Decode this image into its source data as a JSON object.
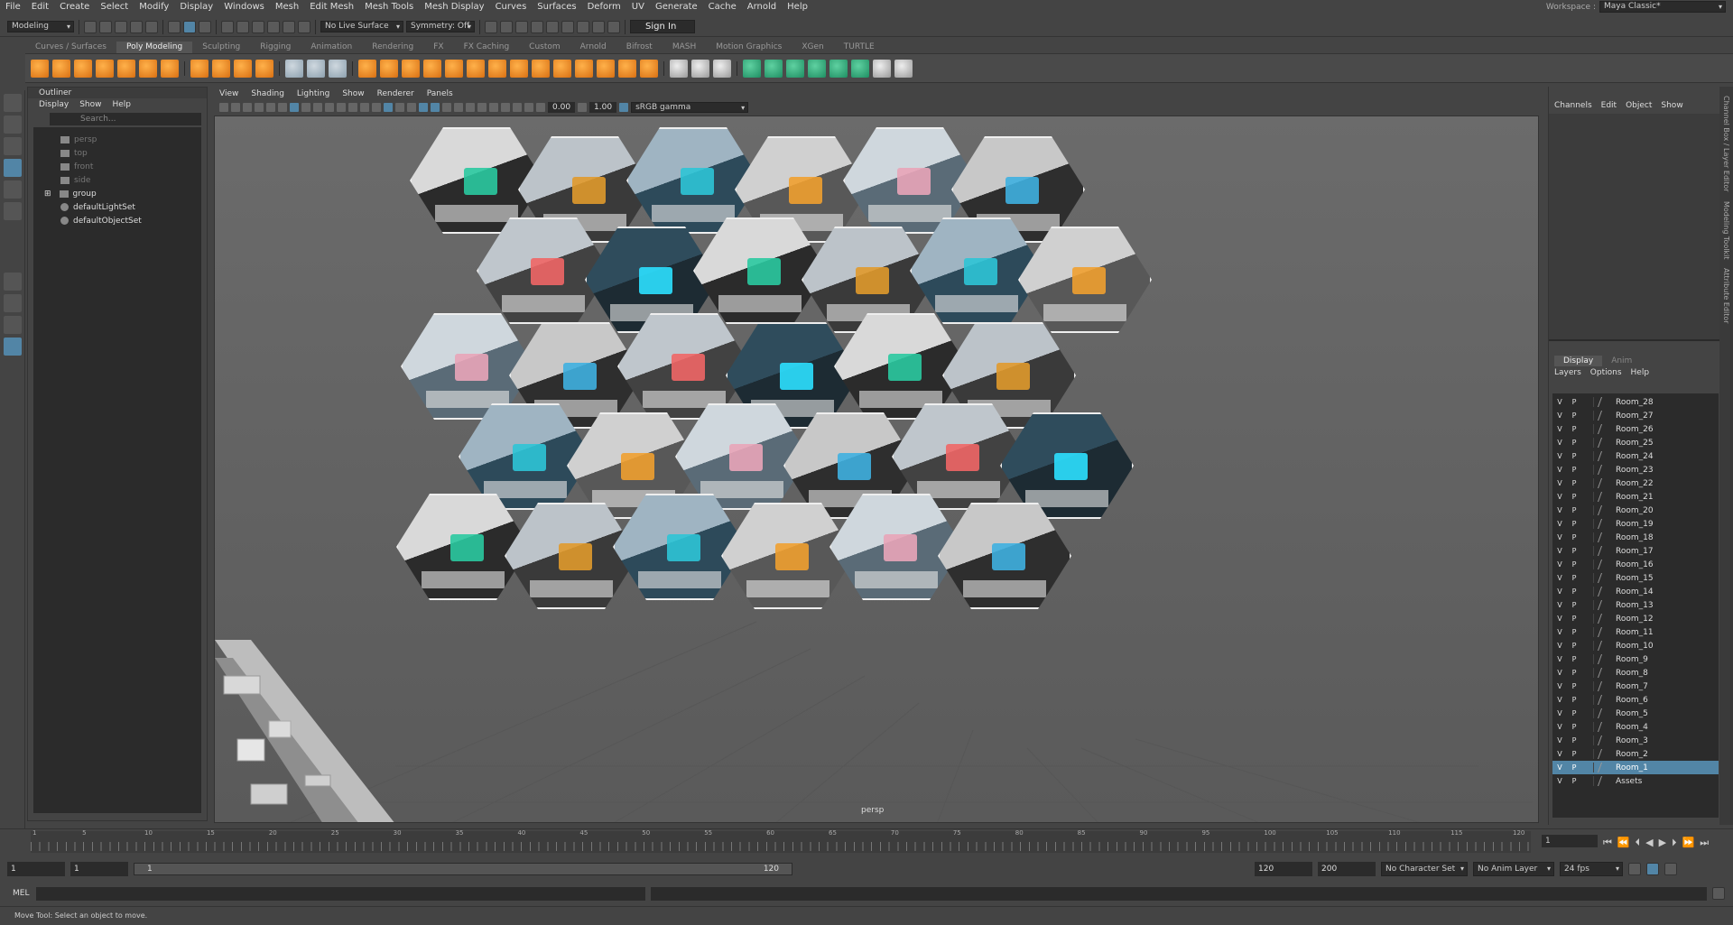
{
  "menubar": {
    "items": [
      "File",
      "Edit",
      "Create",
      "Select",
      "Modify",
      "Display",
      "Windows",
      "Mesh",
      "Edit Mesh",
      "Mesh Tools",
      "Mesh Display",
      "Curves",
      "Surfaces",
      "Deform",
      "UV",
      "Generate",
      "Cache",
      "Arnold",
      "Help"
    ],
    "workspace_label": "Workspace :",
    "workspace_value": "Maya Classic*"
  },
  "statusline": {
    "mode": "Modeling",
    "live_surface": "No Live Surface",
    "symmetry": "Symmetry: Off",
    "sign_in": "Sign In"
  },
  "shelf": {
    "tabs": [
      "Curves / Surfaces",
      "Poly Modeling",
      "Sculpting",
      "Rigging",
      "Animation",
      "Rendering",
      "FX",
      "FX Caching",
      "Custom",
      "Arnold",
      "Bifrost",
      "MASH",
      "Motion Graphics",
      "XGen",
      "TURTLE"
    ],
    "active_tab": "Poly Modeling"
  },
  "outliner": {
    "title": "Outliner",
    "menu": [
      "Display",
      "Show",
      "Help"
    ],
    "search_placeholder": "Search...",
    "items": [
      {
        "label": "persp",
        "icon": "camera-icon",
        "dim": true
      },
      {
        "label": "top",
        "icon": "camera-icon",
        "dim": true
      },
      {
        "label": "front",
        "icon": "camera-icon",
        "dim": true
      },
      {
        "label": "side",
        "icon": "camera-icon",
        "dim": true
      },
      {
        "label": "group",
        "icon": "group-icon",
        "dim": false
      },
      {
        "label": "defaultLightSet",
        "icon": "set-icon",
        "dim": false
      },
      {
        "label": "defaultObjectSet",
        "icon": "set-icon",
        "dim": false
      }
    ]
  },
  "viewport": {
    "menu": [
      "View",
      "Shading",
      "Lighting",
      "Show",
      "Renderer",
      "Panels"
    ],
    "exposure": "0.00",
    "gamma": "1.00",
    "color_space": "sRGB gamma",
    "camera_label": "persp"
  },
  "channelbox": {
    "menu": [
      "Channels",
      "Edit",
      "Object",
      "Show"
    ]
  },
  "layers": {
    "tabs": [
      "Display",
      "Anim"
    ],
    "active_tab": "Display",
    "menu": [
      "Layers",
      "Options",
      "Help"
    ],
    "visibility_flag": "V",
    "playback_flag": "P",
    "rows": [
      "Room_28",
      "Room_27",
      "Room_26",
      "Room_25",
      "Room_24",
      "Room_23",
      "Room_22",
      "Room_21",
      "Room_20",
      "Room_19",
      "Room_18",
      "Room_17",
      "Room_16",
      "Room_15",
      "Room_14",
      "Room_13",
      "Room_12",
      "Room_11",
      "Room_10",
      "Room_9",
      "Room_8",
      "Room_7",
      "Room_6",
      "Room_5",
      "Room_4",
      "Room_3",
      "Room_2",
      "Room_1",
      "Assets"
    ],
    "selected": "Room_1"
  },
  "side_tabs": [
    "Channel Box / Layer Editor",
    "Modeling Toolkit",
    "Attribute Editor"
  ],
  "timeslider": {
    "ticks": [
      "1",
      "5",
      "10",
      "15",
      "20",
      "25",
      "30",
      "35",
      "40",
      "45",
      "50",
      "55",
      "60",
      "65",
      "70",
      "75",
      "80",
      "85",
      "90",
      "95",
      "100",
      "105",
      "110",
      "115",
      "120"
    ],
    "current_frame": "1"
  },
  "range": {
    "start": "1",
    "playback_start": "1",
    "slider_start": "1",
    "slider_end": "120",
    "playback_end": "120",
    "end": "200",
    "character_set": "No Character Set",
    "anim_layer": "No Anim Layer",
    "fps": "24 fps"
  },
  "command_line": {
    "label": "MEL"
  },
  "help_line": "Move Tool: Select an object to move.",
  "colors": {
    "accent": "#5285a6",
    "ui_bg": "#444444",
    "field_bg": "#2b2b2b"
  }
}
